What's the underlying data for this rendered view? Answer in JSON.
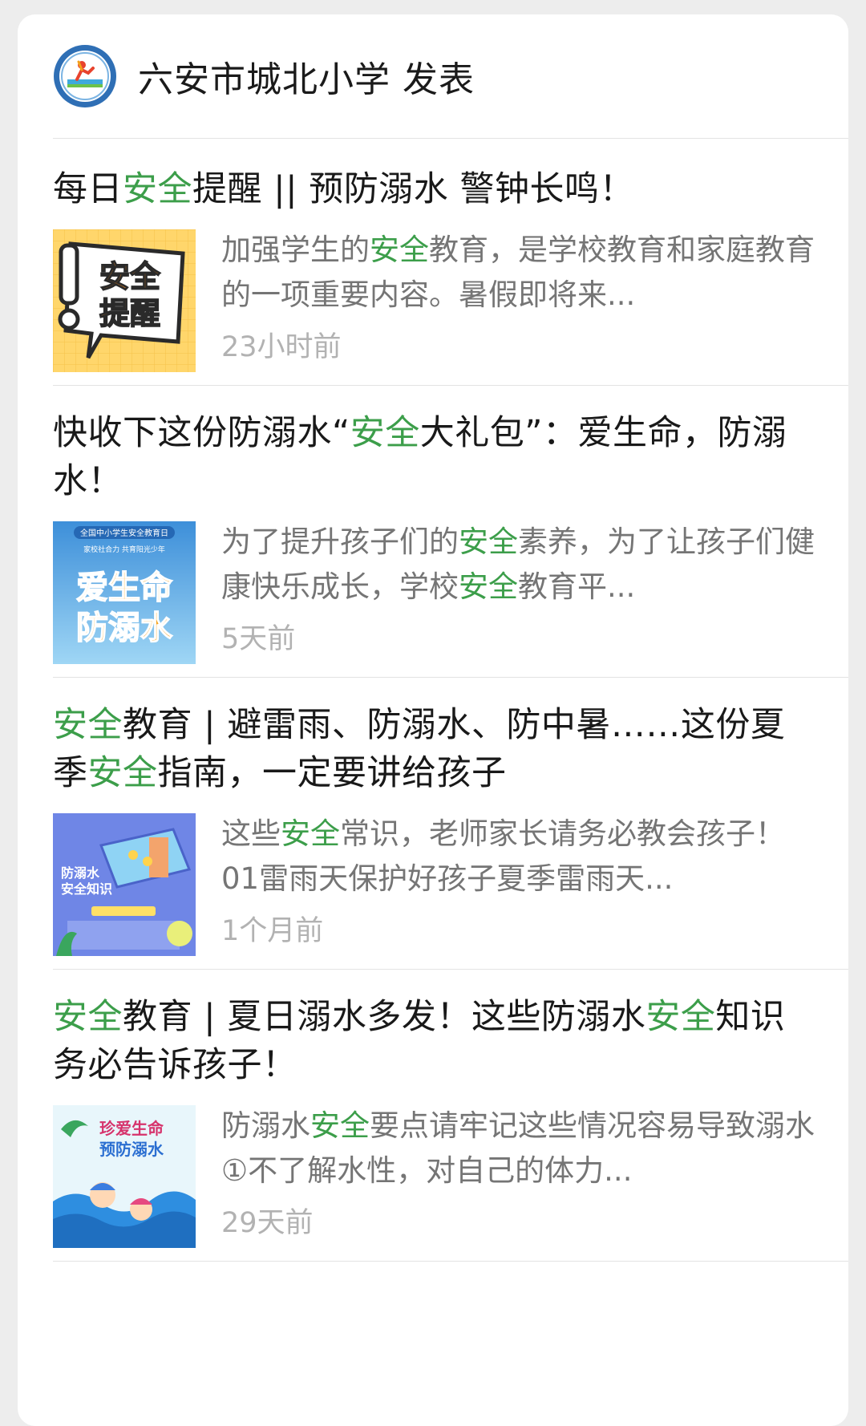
{
  "header": {
    "author": "六安市城北小学",
    "action": "发表"
  },
  "articles": [
    {
      "title": [
        {
          "text": "每日"
        },
        {
          "text": "安全",
          "hl": true
        },
        {
          "text": "提醒 || 预防溺水 警钟长鸣！"
        }
      ],
      "summary": [
        {
          "text": "加强学生的"
        },
        {
          "text": "安全",
          "hl": true
        },
        {
          "text": "教育，是学校教育和家庭教育的一项重要内容。暑假即将来..."
        }
      ],
      "time": "23小时前",
      "thumb_text": [
        "安全",
        "提醒"
      ]
    },
    {
      "title": [
        {
          "text": "快收下这份防溺水“"
        },
        {
          "text": "安全",
          "hl": true
        },
        {
          "text": "大礼包”：爱生命，防溺水！"
        }
      ],
      "summary": [
        {
          "text": "为了提升孩子们的"
        },
        {
          "text": "安全",
          "hl": true
        },
        {
          "text": "素养，为了让孩子们健康快乐成长，学校"
        },
        {
          "text": "安全",
          "hl": true
        },
        {
          "text": "教育平..."
        }
      ],
      "time": "5天前",
      "thumb_text": [
        "全国中小学生安全教育日",
        "家校社合力 共育阳光少年",
        "爱生命",
        "防溺水"
      ]
    },
    {
      "title": [
        {
          "text": "安全",
          "hl": true
        },
        {
          "text": "教育 | 避雷雨、防溺水、防中暑……这份夏季"
        },
        {
          "text": "安全",
          "hl": true
        },
        {
          "text": "指南，一定要讲给孩子"
        }
      ],
      "summary": [
        {
          "text": "这些"
        },
        {
          "text": "安全",
          "hl": true
        },
        {
          "text": "常识，老师家长请务必教会孩子！01雷雨天保护好孩子夏季雷雨天..."
        }
      ],
      "time": "1个月前",
      "thumb_text": [
        "防溺水",
        "安全知识"
      ]
    },
    {
      "title": [
        {
          "text": "安全",
          "hl": true
        },
        {
          "text": "教育 | 夏日溺水多发！这些防溺水"
        },
        {
          "text": "安全",
          "hl": true
        },
        {
          "text": "知识务必告诉孩子！"
        }
      ],
      "summary": [
        {
          "text": "防溺水"
        },
        {
          "text": "安全",
          "hl": true
        },
        {
          "text": "要点请牢记这些情况容易导致溺水①不了解水性，对自己的体力..."
        }
      ],
      "time": "29天前",
      "thumb_text": [
        "珍爱生命",
        "预防溺水"
      ]
    }
  ],
  "colors": {
    "highlight": "#3c9e4a",
    "meta": "#b2b2b2",
    "summary": "#757575"
  }
}
